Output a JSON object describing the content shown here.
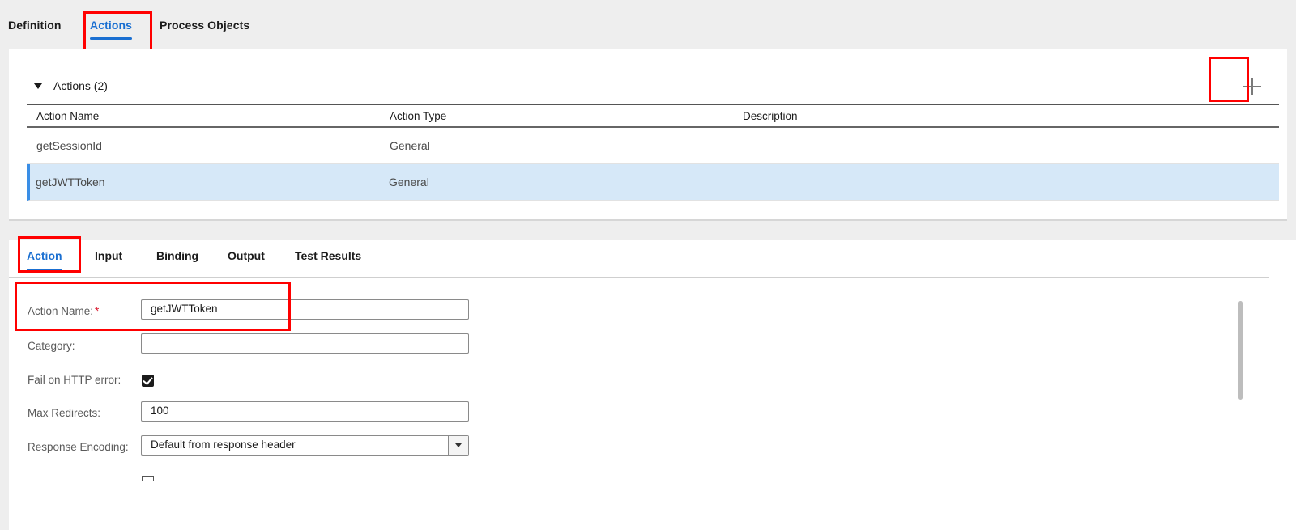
{
  "top_tabs": [
    {
      "label": "Definition",
      "active": false
    },
    {
      "label": "Actions",
      "active": true
    },
    {
      "label": "Process Objects",
      "active": false
    }
  ],
  "actions_section": {
    "title": "Actions (2)",
    "add_icon": "plus-icon",
    "columns": [
      "Action Name",
      "Action Type",
      "Description"
    ],
    "rows": [
      {
        "name": "getSessionId",
        "type": "General",
        "description": "",
        "selected": false
      },
      {
        "name": "getJWTToken",
        "type": "General",
        "description": "",
        "selected": true
      }
    ]
  },
  "detail_tabs": [
    {
      "label": "Action",
      "active": true
    },
    {
      "label": "Input",
      "active": false
    },
    {
      "label": "Binding",
      "active": false
    },
    {
      "label": "Output",
      "active": false
    },
    {
      "label": "Test Results",
      "active": false
    }
  ],
  "form": {
    "action_name_label": "Action Name:",
    "required_mark": "*",
    "action_name_value": "getJWTToken",
    "category_label": "Category:",
    "category_value": "",
    "fail_on_http_label": "Fail on HTTP error:",
    "fail_on_http_checked": true,
    "max_redirects_label": "Max Redirects:",
    "max_redirects_value": "100",
    "response_encoding_label": "Response Encoding:",
    "response_encoding_value": "Default from response header"
  },
  "colors": {
    "accent": "#1a6fd1",
    "selected_row": "#d6e8f8",
    "highlight_box": "#ff0000",
    "required": "#d9162b"
  }
}
